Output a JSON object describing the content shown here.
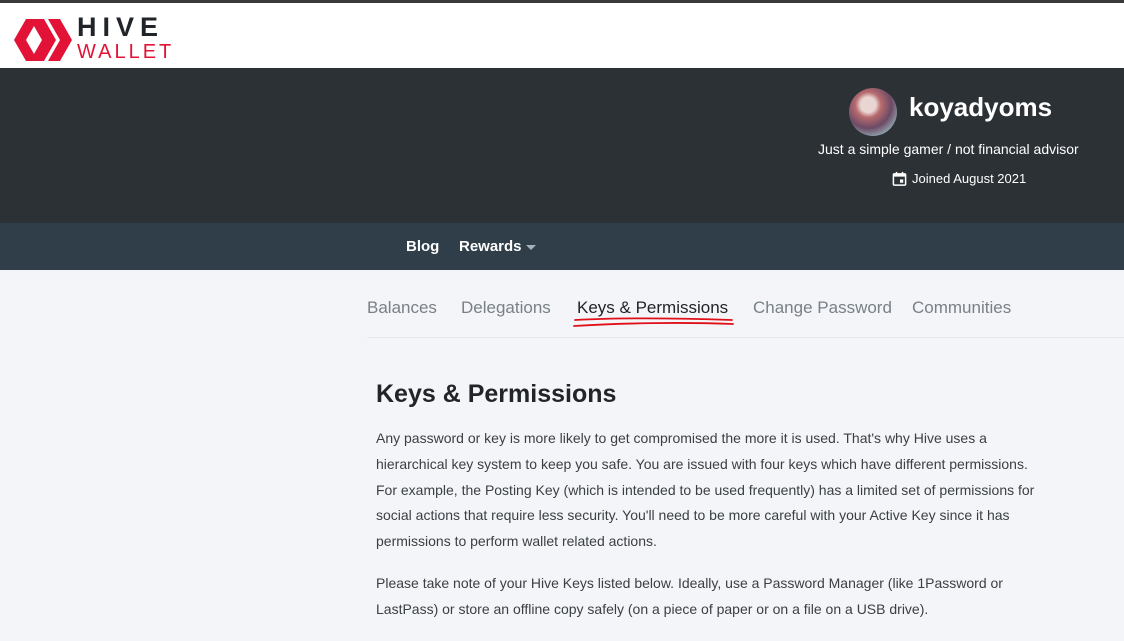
{
  "logo": {
    "brand": "HIVE",
    "product": "WALLET"
  },
  "profile": {
    "username": "koyadyoms",
    "about": "Just a simple gamer / not financial advisor",
    "joined": "Joined August 2021"
  },
  "subnav": {
    "blog": "Blog",
    "rewards": "Rewards"
  },
  "tabs": [
    {
      "label": "Balances"
    },
    {
      "label": "Delegations"
    },
    {
      "label": "Keys & Permissions",
      "active": true
    },
    {
      "label": "Change Password"
    },
    {
      "label": "Communities"
    }
  ],
  "content": {
    "title": "Keys & Permissions",
    "paragraphs": [
      "Any password or key is more likely to get compromised the more it is used. That's why Hive uses a hierarchical key system to keep you safe. You are issued with four keys which have different permissions. For example, the Posting Key (which is intended to be used frequently) has a limited set of permissions for social actions that require less security. You'll need to be more careful with your Active Key since it has permissions to perform wallet related actions.",
      "Please take note of your Hive Keys listed below. Ideally, use a Password Manager (like 1Password or LastPass) or store an offline copy safely (on a piece of paper or on a file on a USB drive)."
    ]
  },
  "colors": {
    "brand_red": "#e31337",
    "hero_bg": "#2c3136",
    "subnav_bg": "#2f3e48",
    "page_bg": "#f4f5f8",
    "annotation_red": "#e0101a"
  },
  "icons": [
    "hive-logo-icon",
    "calendar-icon",
    "chevron-down-icon"
  ]
}
